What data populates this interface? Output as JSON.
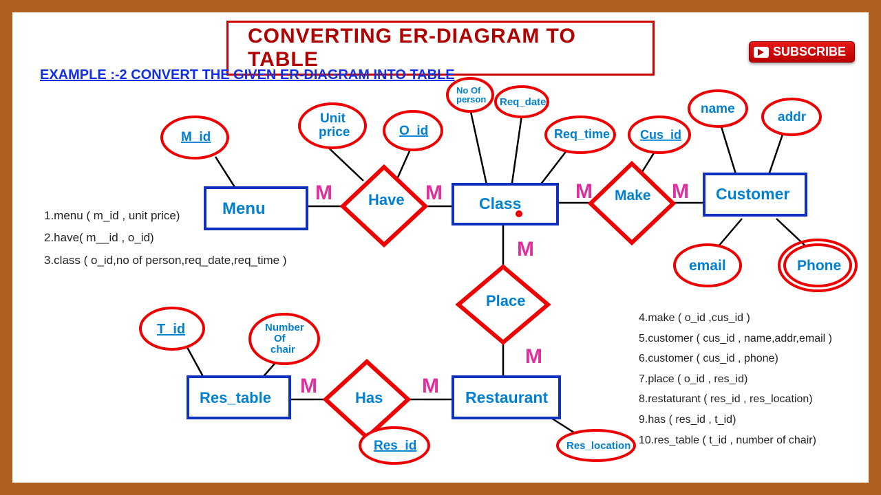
{
  "title": "CONVERTING ER-DIAGRAM TO TABLE",
  "subtitle": "EXAMPLE :-2    CONVERT THE  GIVEN ER-DIAGRAM INTO TABLE",
  "subscribe": "SUBSCRIBE",
  "entities": {
    "menu": "Menu",
    "class": "Class",
    "customer": "Customer",
    "res_table": "Res_table",
    "restaurant": "Restaurant"
  },
  "relationships": {
    "have": "Have",
    "make": "Make",
    "place": "Place",
    "has": "Has"
  },
  "attributes": {
    "m_id": "M_id",
    "unit_price1": "Unit",
    "unit_price2": "price",
    "o_id": "O_id",
    "no_of_person1": "No Of",
    "no_of_person2": "person",
    "req_date": "Req_date",
    "req_time": "Req_time",
    "cus_id": "Cus_id",
    "name": "name",
    "addr": "addr",
    "email": "email",
    "phone": "Phone",
    "t_id": "T_id",
    "num_chair1": "Number",
    "num_chair2": "Of",
    "num_chair3": "chair",
    "res_id": "Res_id",
    "res_location": "Res_location"
  },
  "cardinality": "M",
  "schema_left": [
    "1.menu ( m_id , unit price)",
    "2.have( m__id   , o_id)",
    "3.class ( o_id,no of person,req_date,req_time )"
  ],
  "schema_right": [
    "4.make ( o_id ,cus_id )",
    "5.customer ( cus_id , name,addr,email )",
    "6.customer ( cus_id , phone)",
    "7.place ( o_id , res_id)",
    "8.restaturant ( res_id , res_location)",
    "9.has ( res_id , t_id)",
    "10.res_table ( t_id  , number of chair)"
  ]
}
